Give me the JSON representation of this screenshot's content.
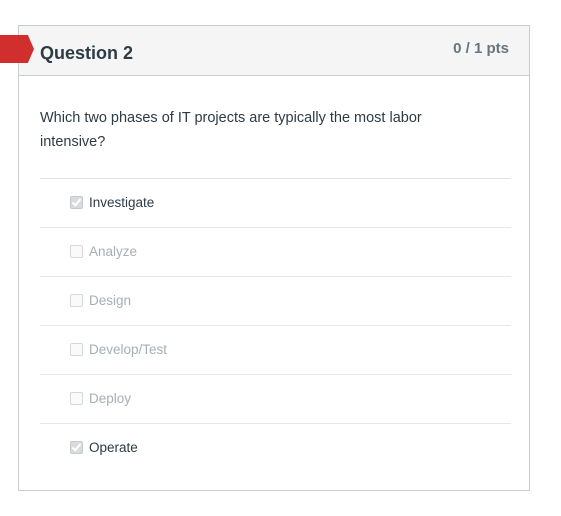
{
  "question": {
    "title": "Question 2",
    "points": "0 / 1 pts",
    "flag_color": "#d12f2e",
    "text": "Which two phases of IT projects are typically the most labor intensive?",
    "answers": [
      {
        "label": "Investigate",
        "checked": true
      },
      {
        "label": "Analyze",
        "checked": false
      },
      {
        "label": "Design",
        "checked": false
      },
      {
        "label": "Develop/Test",
        "checked": false
      },
      {
        "label": "Deploy",
        "checked": false
      },
      {
        "label": "Operate",
        "checked": true
      }
    ]
  }
}
